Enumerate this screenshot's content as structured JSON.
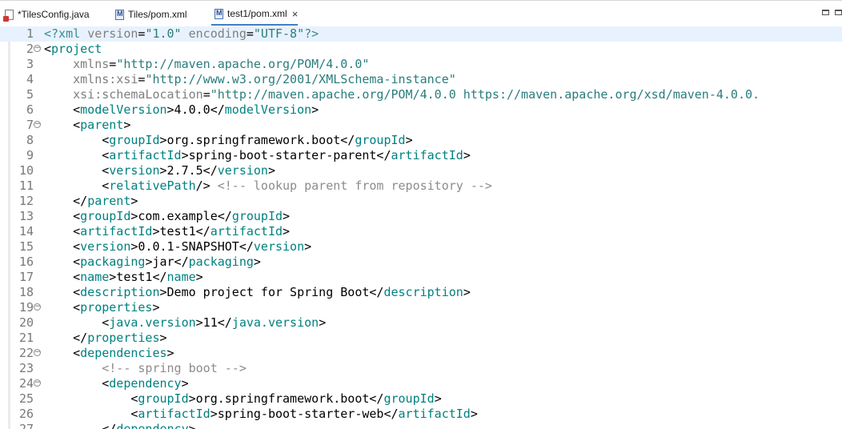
{
  "tabs": [
    {
      "label": "*TilesConfig.java",
      "icon": "java-file-icon",
      "active": false
    },
    {
      "label": "Tiles/pom.xml",
      "icon": "maven-pom-icon",
      "active": false
    },
    {
      "label": "test1/pom.xml",
      "icon": "maven-pom-icon",
      "active": true
    }
  ],
  "close_glyph": "×",
  "colors": {
    "tag": "#008080",
    "attribute": "#7f7f7f",
    "string": "#2a7c7c",
    "comment": "#8c8c8c",
    "current_line": "#e8f2fe"
  },
  "editor": {
    "lines": [
      {
        "n": "1",
        "fold": false,
        "text": "<?xml version=\"1.0\" encoding=\"UTF-8\"?>"
      },
      {
        "n": "2",
        "fold": true,
        "text": "<project"
      },
      {
        "n": "3",
        "fold": false,
        "text": "    xmlns=\"http://maven.apache.org/POM/4.0.0\""
      },
      {
        "n": "4",
        "fold": false,
        "text": "    xmlns:xsi=\"http://www.w3.org/2001/XMLSchema-instance\""
      },
      {
        "n": "5",
        "fold": false,
        "text": "    xsi:schemaLocation=\"http://maven.apache.org/POM/4.0.0 https://maven.apache.org/xsd/maven-4.0.0."
      },
      {
        "n": "6",
        "fold": false,
        "text": "    <modelVersion>4.0.0</modelVersion>"
      },
      {
        "n": "7",
        "fold": true,
        "text": "    <parent>"
      },
      {
        "n": "8",
        "fold": false,
        "text": "        <groupId>org.springframework.boot</groupId>"
      },
      {
        "n": "9",
        "fold": false,
        "text": "        <artifactId>spring-boot-starter-parent</artifactId>"
      },
      {
        "n": "10",
        "fold": false,
        "text": "        <version>2.7.5</version>"
      },
      {
        "n": "11",
        "fold": false,
        "text": "        <relativePath/> <!-- lookup parent from repository -->"
      },
      {
        "n": "12",
        "fold": false,
        "text": "    </parent>"
      },
      {
        "n": "13",
        "fold": false,
        "text": "    <groupId>com.example</groupId>"
      },
      {
        "n": "14",
        "fold": false,
        "text": "    <artifactId>test1</artifactId>"
      },
      {
        "n": "15",
        "fold": false,
        "text": "    <version>0.0.1-SNAPSHOT</version>"
      },
      {
        "n": "16",
        "fold": false,
        "text": "    <packaging>jar</packaging>"
      },
      {
        "n": "17",
        "fold": false,
        "text": "    <name>test1</name>"
      },
      {
        "n": "18",
        "fold": false,
        "text": "    <description>Demo project for Spring Boot</description>"
      },
      {
        "n": "19",
        "fold": true,
        "text": "    <properties>"
      },
      {
        "n": "20",
        "fold": false,
        "text": "        <java.version>11</java.version>"
      },
      {
        "n": "21",
        "fold": false,
        "text": "    </properties>"
      },
      {
        "n": "22",
        "fold": true,
        "text": "    <dependencies>"
      },
      {
        "n": "23",
        "fold": false,
        "text": "        <!-- spring boot -->"
      },
      {
        "n": "24",
        "fold": true,
        "text": "        <dependency>"
      },
      {
        "n": "25",
        "fold": false,
        "text": "            <groupId>org.springframework.boot</groupId>"
      },
      {
        "n": "26",
        "fold": false,
        "text": "            <artifactId>spring-boot-starter-web</artifactId>"
      },
      {
        "n": "27",
        "fold": false,
        "text": "        </dependency>"
      }
    ]
  }
}
